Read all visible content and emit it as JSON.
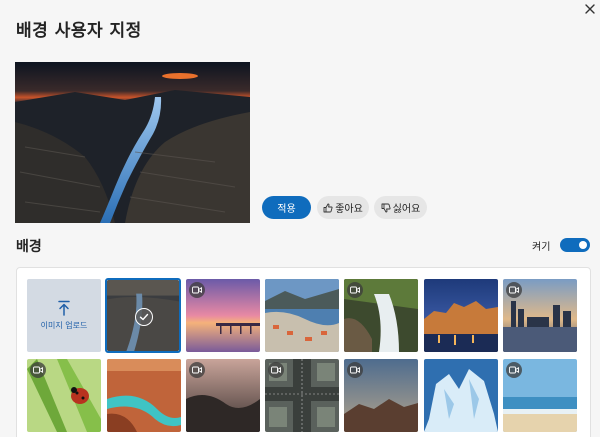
{
  "dialog": {
    "title": "배경 사용자 지정",
    "close_icon": "close-icon"
  },
  "actions": {
    "apply_label": "적용",
    "like_label": "좋아요",
    "dislike_label": "싫어요"
  },
  "backgrounds": {
    "section_title": "배경",
    "toggle_label": "켜기",
    "toggle_on": true,
    "upload_label": "이미지 업로드",
    "tiles": [
      {
        "name": "tile-coastal-rocks",
        "video": false,
        "selected": true
      },
      {
        "name": "tile-sunset-pier",
        "video": true
      },
      {
        "name": "tile-harbor-town",
        "video": false
      },
      {
        "name": "tile-waterfall",
        "video": true
      },
      {
        "name": "tile-castle-night",
        "video": false
      },
      {
        "name": "tile-city-skyline",
        "video": true
      },
      {
        "name": "tile-ladybug",
        "video": true
      },
      {
        "name": "tile-canyon-river",
        "video": false
      },
      {
        "name": "tile-misty-hills",
        "video": true
      },
      {
        "name": "tile-aerial-road",
        "video": false
      },
      {
        "name": "tile-mountain-dusk",
        "video": true
      },
      {
        "name": "tile-iceberg",
        "video": false
      },
      {
        "name": "tile-beach",
        "video": true
      }
    ]
  },
  "colors": {
    "accent": "#0f6cbd",
    "background": "#f6f6f6"
  }
}
